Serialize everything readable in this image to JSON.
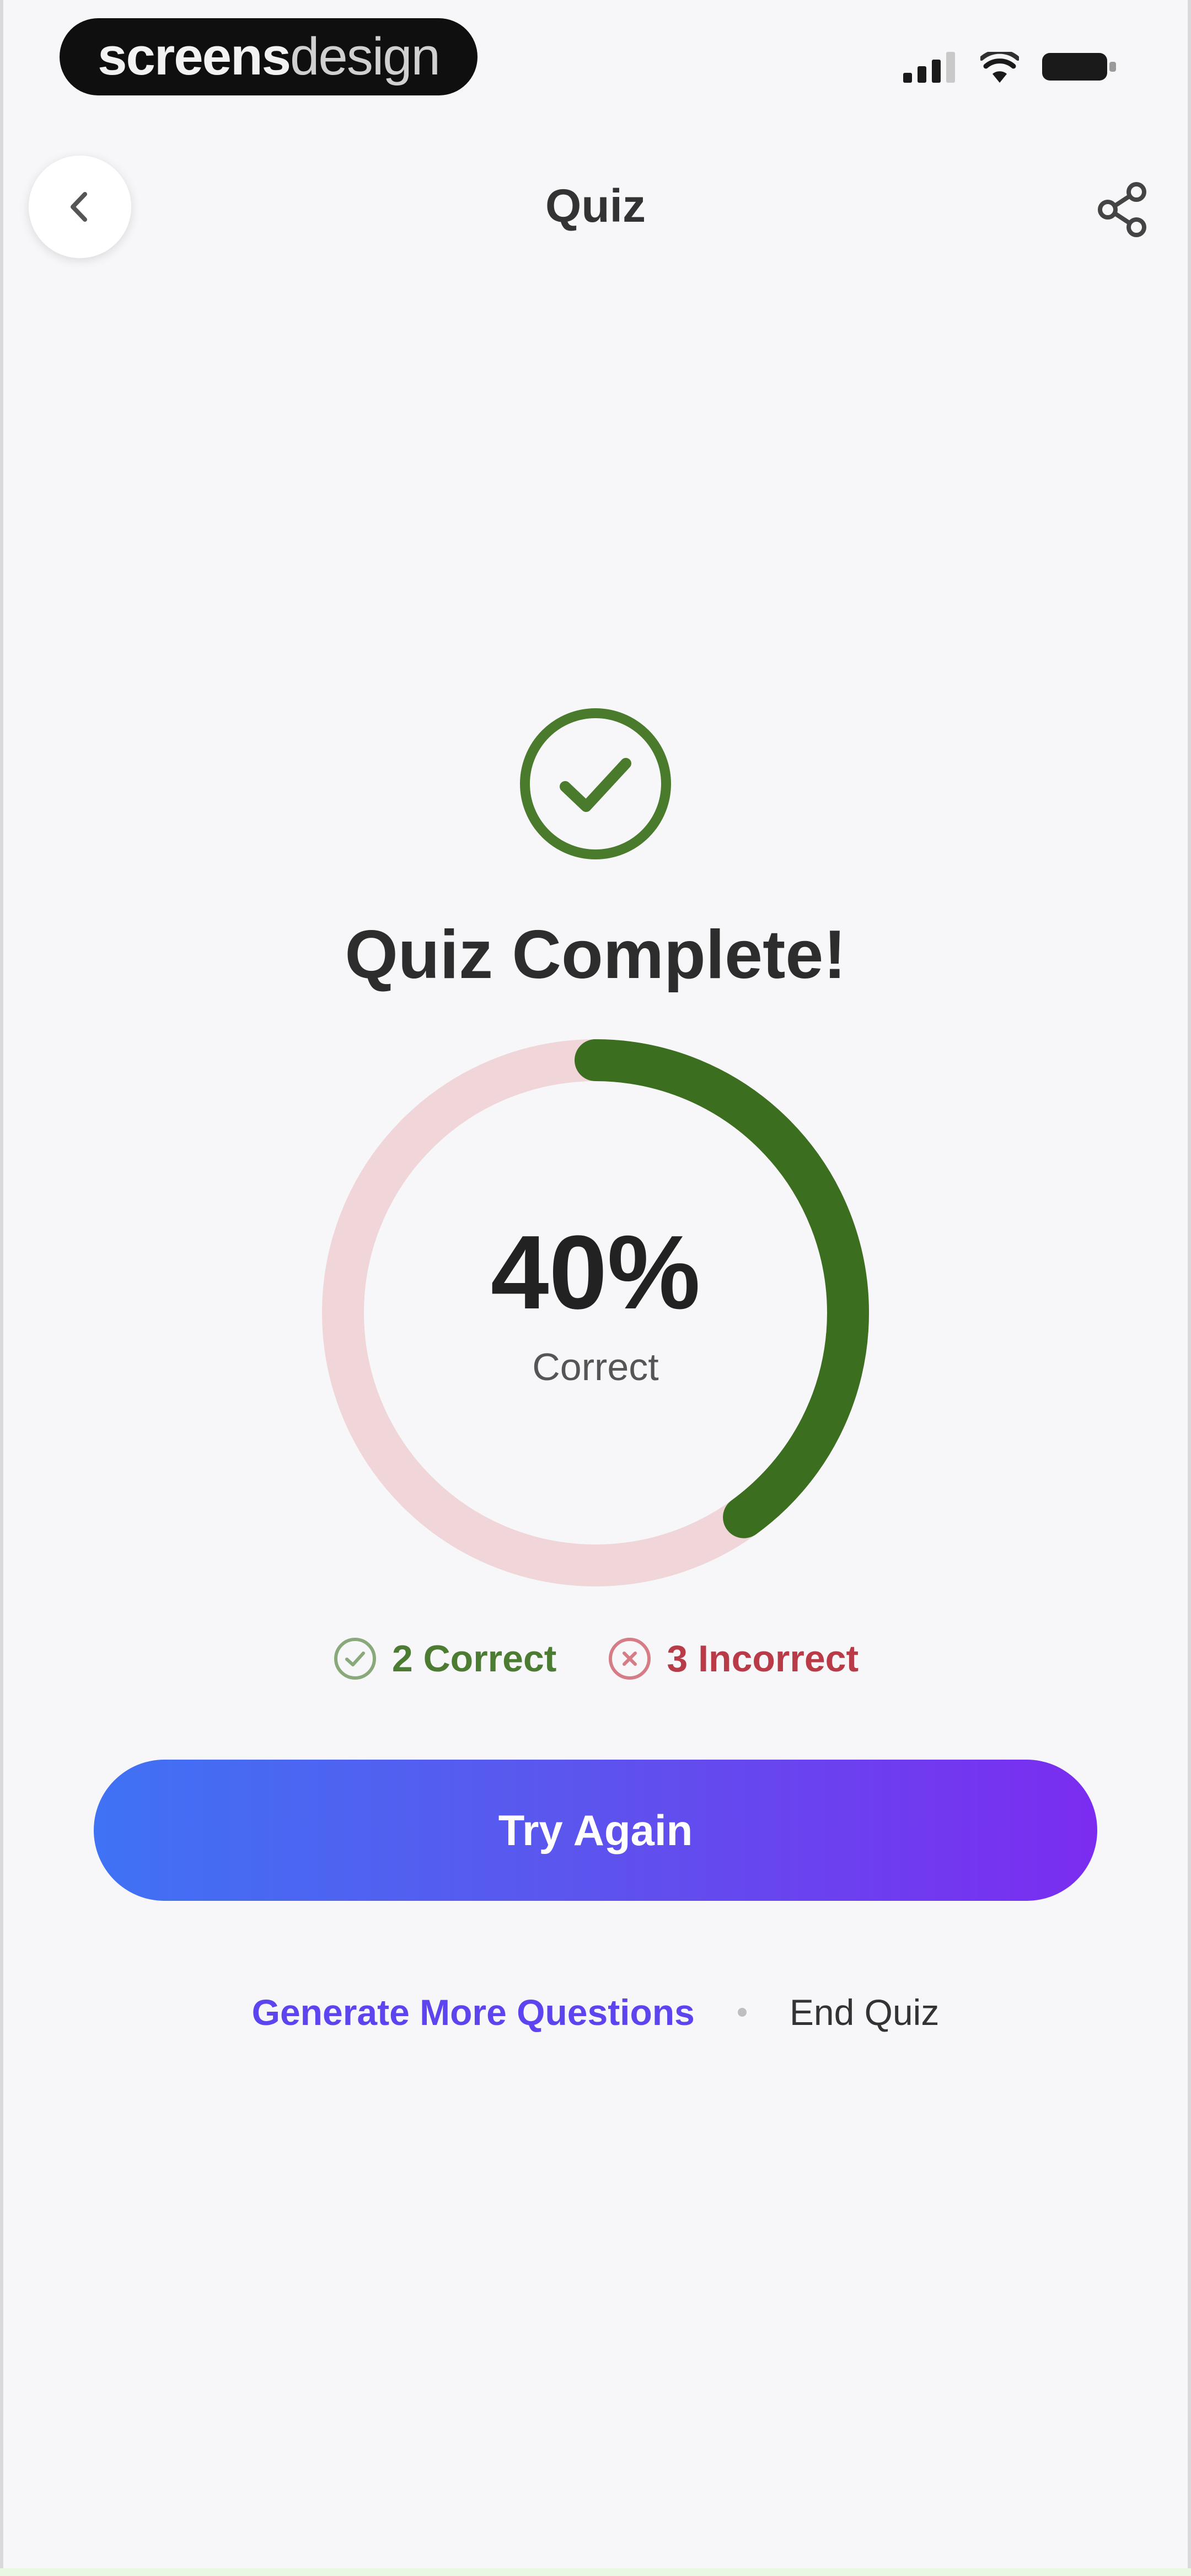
{
  "status_bar": {
    "watermark_bold": "screens",
    "watermark_light": "design"
  },
  "header": {
    "title": "Quiz",
    "back_icon": "chevron-left-icon",
    "share_icon": "share-icon"
  },
  "result": {
    "title": "Quiz Complete!",
    "percent": "40%",
    "percent_label": "Correct",
    "progress": 0.4,
    "correct_text": "2 Correct",
    "incorrect_text": "3 Incorrect"
  },
  "actions": {
    "try_again": "Try Again",
    "generate_more": "Generate More Questions",
    "end_quiz": "End Quiz"
  },
  "colors": {
    "correct": "#3c6e1f",
    "incorrect_track": "#f0d5d9",
    "accent_start": "#3f72f5",
    "accent_end": "#7b2cf0"
  }
}
